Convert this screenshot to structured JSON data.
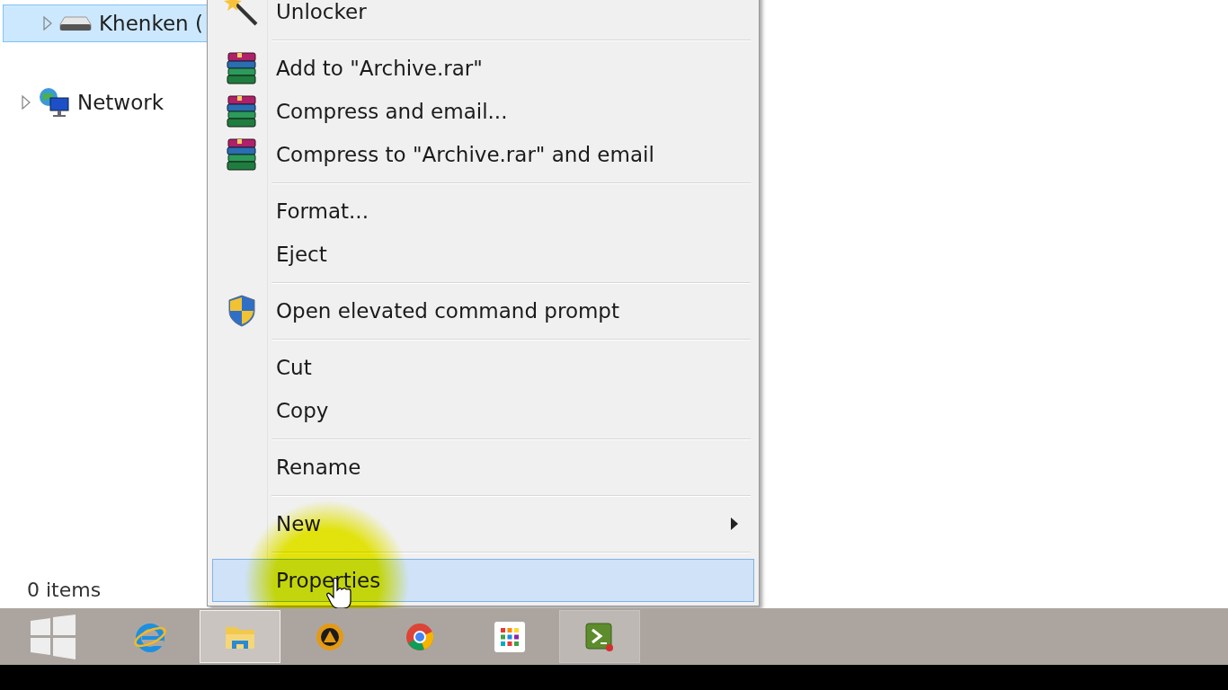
{
  "navigation": {
    "items": [
      {
        "label": "Khenken (",
        "kind": "drive",
        "selected": true
      },
      {
        "label": "Network",
        "kind": "network",
        "selected": false
      }
    ],
    "status": "0 items"
  },
  "context_menu": {
    "groups": [
      [
        {
          "label": "Unlocker",
          "kind": "wand",
          "selected": false
        }
      ],
      [
        {
          "label": "Add to \"Archive.rar\"",
          "kind": "archive",
          "selected": false
        },
        {
          "label": "Compress and email...",
          "kind": "archive",
          "selected": false
        },
        {
          "label": "Compress to \"Archive.rar\" and email",
          "kind": "archive",
          "selected": false
        }
      ],
      [
        {
          "label": "Format...",
          "kind": "plain",
          "selected": false
        },
        {
          "label": "Eject",
          "kind": "plain",
          "selected": false
        }
      ],
      [
        {
          "label": "Open elevated command prompt",
          "kind": "shield",
          "selected": false
        }
      ],
      [
        {
          "label": "Cut",
          "kind": "plain",
          "selected": false
        },
        {
          "label": "Copy",
          "kind": "plain",
          "selected": false
        }
      ],
      [
        {
          "label": "Rename",
          "kind": "plain",
          "selected": false
        }
      ],
      [
        {
          "label": "New",
          "kind": "submenu",
          "selected": false
        }
      ],
      [
        {
          "label": "Properties",
          "kind": "plain",
          "selected": true
        }
      ]
    ]
  },
  "taskbar": {
    "apps": [
      {
        "kind": "browser-e",
        "open": false,
        "selected": false
      },
      {
        "kind": "folder",
        "open": true,
        "selected": true
      },
      {
        "kind": "media",
        "open": false,
        "selected": false
      },
      {
        "kind": "chrome",
        "open": false,
        "selected": false
      },
      {
        "kind": "grid",
        "open": false,
        "selected": false
      },
      {
        "kind": "terminal",
        "open": true,
        "selected": false
      }
    ]
  }
}
